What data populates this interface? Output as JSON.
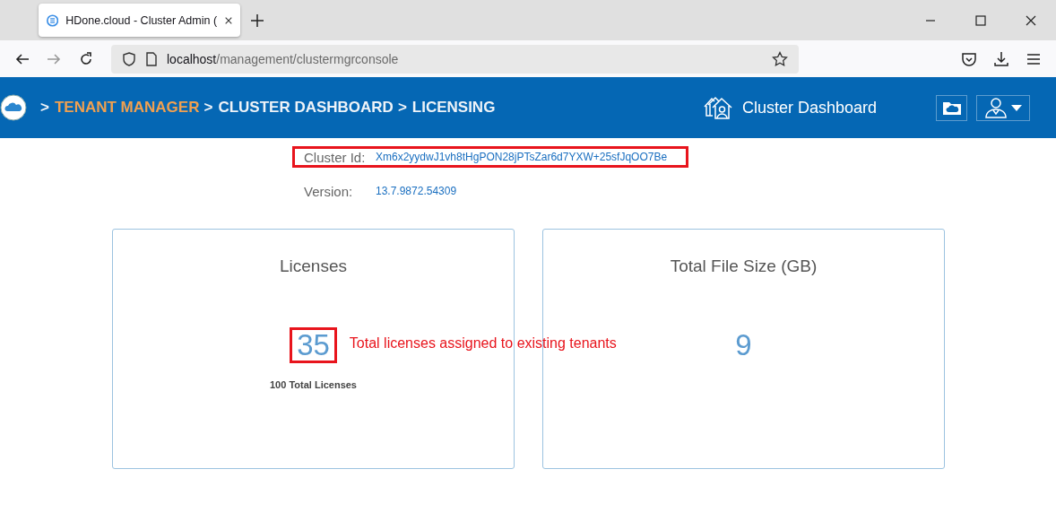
{
  "browser": {
    "tab": {
      "title": "HDone.cloud - Cluster Admin (",
      "selected": true
    },
    "url": {
      "host": "localhost",
      "path": "/management/clustermgrconsole"
    }
  },
  "header": {
    "breadcrumbs": [
      {
        "separator": ">",
        "label": "TENANT MANAGER",
        "kind": "link"
      },
      {
        "separator": ">",
        "label": "CLUSTER DASHBOARD",
        "kind": "plain"
      },
      {
        "separator": ">",
        "label": "LICENSING",
        "kind": "plain"
      }
    ],
    "title": "Cluster Dashboard"
  },
  "info": [
    {
      "label": "Cluster Id:",
      "value": "Xm6x2yydwJ1vh8tHgPON28jPTsZar6d7YXW+25sfJqOO7Be",
      "highlighted": true
    },
    {
      "label": "Version:",
      "value": "13.7.9872.54309",
      "highlighted": false
    }
  ],
  "cards": [
    {
      "title": "Licenses",
      "value": "35",
      "highlighted": true,
      "caption": "100 Total Licenses",
      "annotation": "Total licenses assigned to existing tenants"
    },
    {
      "title": "Total File Size (GB)",
      "value": "9",
      "highlighted": false
    }
  ]
}
